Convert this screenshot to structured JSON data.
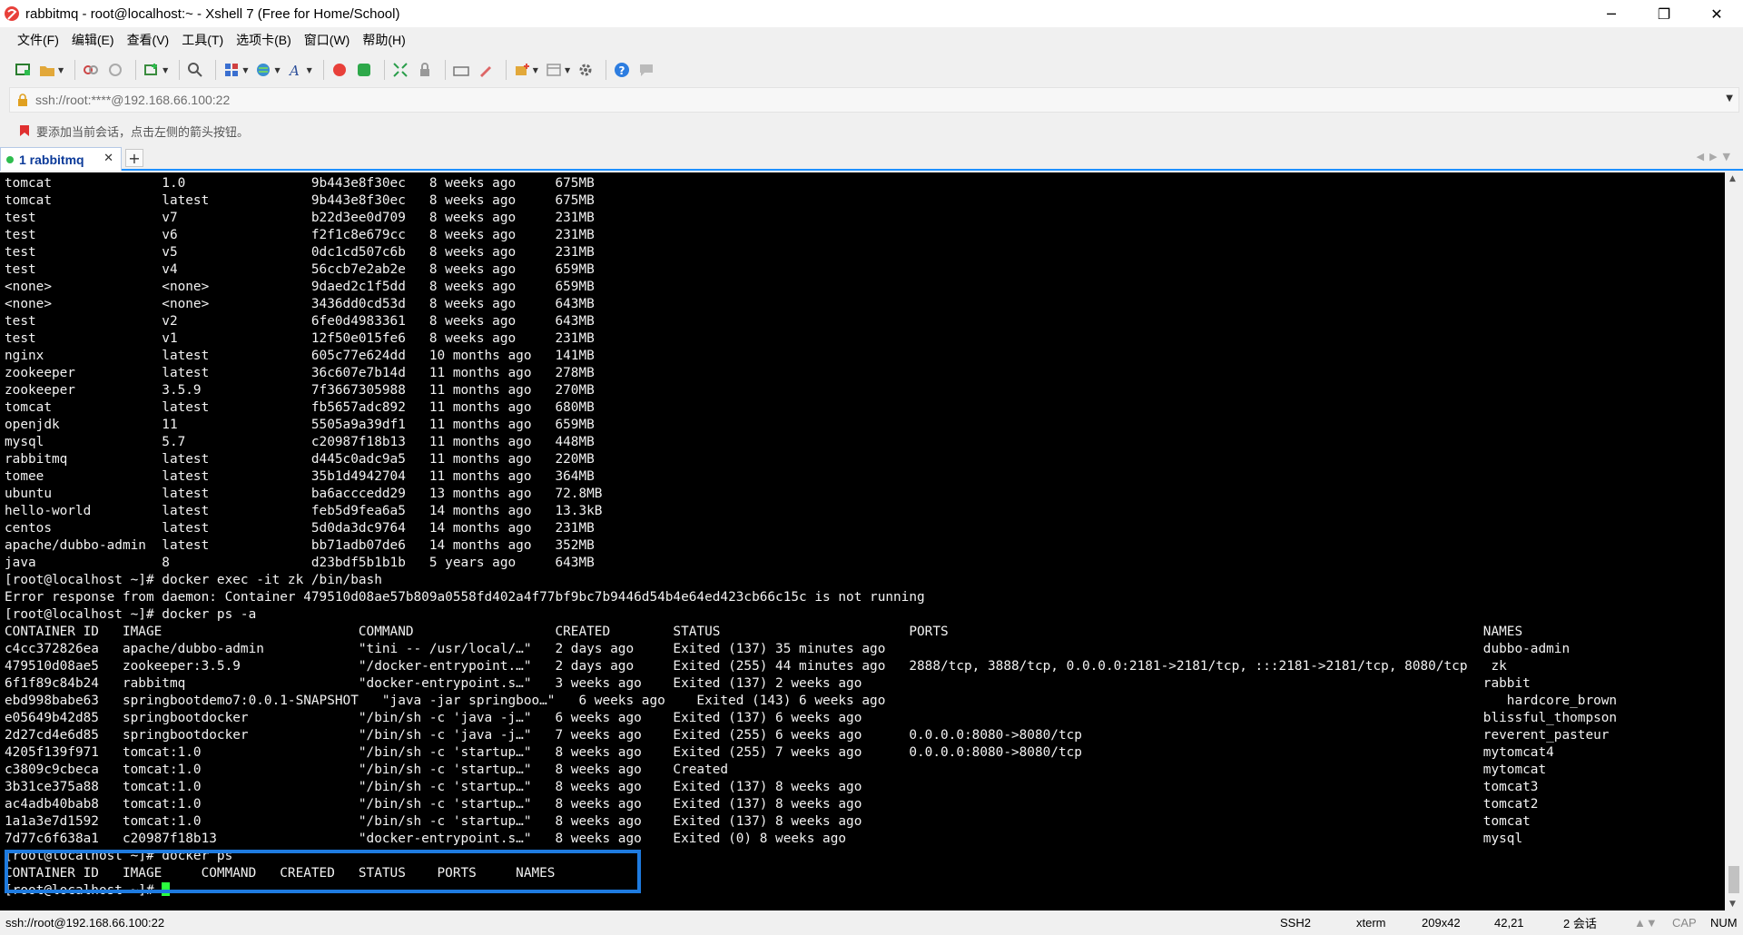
{
  "window": {
    "title": "rabbitmq - root@localhost:~ - Xshell 7 (Free for Home/School)",
    "minimize": "─",
    "restore": "❐",
    "close": "✕"
  },
  "menu": [
    "文件(F)",
    "编辑(E)",
    "查看(V)",
    "工具(T)",
    "选项卡(B)",
    "窗口(W)",
    "帮助(H)"
  ],
  "address": {
    "url": "ssh://root:****@192.168.66.100:22"
  },
  "hint": "要添加当前会话，点击左侧的箭头按钮。",
  "tabs": [
    {
      "label": "1 rabbitmq",
      "close": "✕"
    }
  ],
  "new_tab": "+",
  "terminal": {
    "lines": [
      "tomcat              1.0                9b443e8f30ec   8 weeks ago     675MB",
      "tomcat              latest             9b443e8f30ec   8 weeks ago     675MB",
      "test                v7                 b22d3ee0d709   8 weeks ago     231MB",
      "test                v6                 f2f1c8e679cc   8 weeks ago     231MB",
      "test                v5                 0dc1cd507c6b   8 weeks ago     231MB",
      "test                v4                 56ccb7e2ab2e   8 weeks ago     659MB",
      "<none>              <none>             9daed2c1f5dd   8 weeks ago     659MB",
      "<none>              <none>             3436dd0cd53d   8 weeks ago     643MB",
      "test                v2                 6fe0d4983361   8 weeks ago     643MB",
      "test                v1                 12f50e015fe6   8 weeks ago     231MB",
      "nginx               latest             605c77e624dd   10 months ago   141MB",
      "zookeeper           latest             36c607e7b14d   11 months ago   278MB",
      "zookeeper           3.5.9              7f3667305988   11 months ago   270MB",
      "tomcat              latest             fb5657adc892   11 months ago   680MB",
      "openjdk             11                 5505a9a39df1   11 months ago   659MB",
      "mysql               5.7                c20987f18b13   11 months ago   448MB",
      "rabbitmq            latest             d445c0adc9a5   11 months ago   220MB",
      "tomee               latest             35b1d4942704   11 months ago   364MB",
      "ubuntu              latest             ba6acccedd29   13 months ago   72.8MB",
      "hello-world         latest             feb5d9fea6a5   14 months ago   13.3kB",
      "centos              latest             5d0da3dc9764   14 months ago   231MB",
      "apache/dubbo-admin  latest             bb71adb07de6   14 months ago   352MB",
      "java                8                  d23bdf5b1b1b   5 years ago     643MB",
      "[root@localhost ~]# docker exec -it zk /bin/bash",
      "Error response from daemon: Container 479510d08ae57b809a0558fd402a4f77bf9bc7b9446d54b4e64ed423cb66c15c is not running",
      "[root@localhost ~]# docker ps -a",
      "CONTAINER ID   IMAGE                         COMMAND                  CREATED        STATUS                        PORTS                                                                    NAMES",
      "c4cc372826ea   apache/dubbo-admin            \"tini -- /usr/local/…\"   2 days ago     Exited (137) 35 minutes ago                                                                            dubbo-admin",
      "479510d08ae5   zookeeper:3.5.9               \"/docker-entrypoint.…\"   2 days ago     Exited (255) 44 minutes ago   2888/tcp, 3888/tcp, 0.0.0.0:2181->2181/tcp, :::2181->2181/tcp, 8080/tcp   zk",
      "6f1f89c84b24   rabbitmq                      \"docker-entrypoint.s…\"   3 weeks ago    Exited (137) 2 weeks ago                                                                               rabbit",
      "ebd998babe63   springbootdemo7:0.0.1-SNAPSHOT   \"java -jar springboo…\"   6 weeks ago    Exited (143) 6 weeks ago                                                                               hardcore_brown",
      "e05649b42d85   springbootdocker              \"/bin/sh -c 'java -j…\"   6 weeks ago    Exited (137) 6 weeks ago                                                                               blissful_thompson",
      "2d27cd4e6d85   springbootdocker              \"/bin/sh -c 'java -j…\"   7 weeks ago    Exited (255) 6 weeks ago      0.0.0.0:8080->8080/tcp                                                   reverent_pasteur",
      "4205f139f971   tomcat:1.0                    \"/bin/sh -c 'startup…\"   8 weeks ago    Exited (255) 7 weeks ago      0.0.0.0:8080->8080/tcp                                                   mytomcat4",
      "c3809c9cbeca   tomcat:1.0                    \"/bin/sh -c 'startup…\"   8 weeks ago    Created                                                                                                mytomcat",
      "3b31ce375a88   tomcat:1.0                    \"/bin/sh -c 'startup…\"   8 weeks ago    Exited (137) 8 weeks ago                                                                               tomcat3",
      "ac4adb40bab8   tomcat:1.0                    \"/bin/sh -c 'startup…\"   8 weeks ago    Exited (137) 8 weeks ago                                                                               tomcat2",
      "1a1a3e7d1592   tomcat:1.0                    \"/bin/sh -c 'startup…\"   8 weeks ago    Exited (137) 8 weeks ago                                                                               tomcat",
      "7d77c6f638a1   c20987f18b13                  \"docker-entrypoint.s…\"   8 weeks ago    Exited (0) 8 weeks ago                                                                                 mysql",
      "[root@localhost ~]# docker ps",
      "CONTAINER ID   IMAGE     COMMAND   CREATED   STATUS    PORTS     NAMES"
    ],
    "prompt": "[root@localhost ~]# "
  },
  "status": {
    "connection": "ssh://root@192.168.66.100:22",
    "protocol": "SSH2",
    "term": "xterm",
    "size": "209x42",
    "cursor_pos": "42,21",
    "sessions": "2 会话",
    "cap": "CAP",
    "num": "NUM"
  },
  "colors": {
    "accent": "#1e7be0",
    "cursor": "#2bff3e",
    "tab_text": "#0b3a99"
  }
}
